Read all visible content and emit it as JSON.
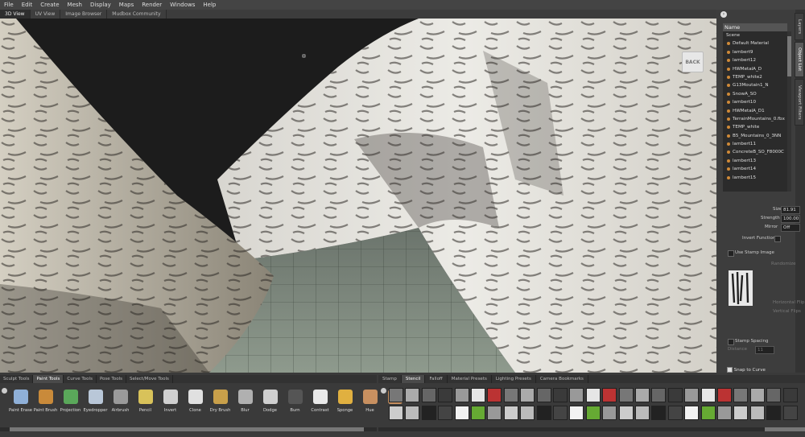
{
  "menu": [
    "File",
    "Edit",
    "Create",
    "Mesh",
    "Display",
    "Maps",
    "Render",
    "Windows",
    "Help"
  ],
  "view_tabs": [
    "3D View",
    "UV View",
    "Image Browser",
    "Mudbox Community"
  ],
  "back_label": "BACK",
  "side_tabs": [
    "Layers",
    "Object List",
    "Viewport Filters"
  ],
  "outliner": {
    "header": "Name",
    "scene": "Scene",
    "items": [
      "Default Material",
      "lambert9",
      "lambert12",
      "HWMetalA_D",
      "TEMP_white2",
      "G13Moutain1_N",
      "SnowA_SO",
      "lambert10",
      "HWMetalA_D1",
      "TerrainMountains_0.fbx",
      "TEMP_white",
      "B5_Mountains_0_3NN",
      "lambert11",
      "ConcreteB_SO_F8000C",
      "lambert13",
      "lambert14",
      "lambert15"
    ]
  },
  "props": {
    "size_label": "Size",
    "size_value": "81.91",
    "strength_label": "Strength",
    "strength_value": "100.00",
    "mirror_label": "Mirror",
    "mirror_value": "Off",
    "invert_label": "Invert Function",
    "use_stamp_label": "Use Stamp Image",
    "randomize_label": "Randomize",
    "horizontal_flip_label": "Horizontal Flip",
    "vertical_flip_label": "Vertical Flips",
    "stamp_spacing_label": "Stamp Spacing",
    "distance_label": "Distance",
    "distance_value": "11",
    "snap_label": "Snap to Curve"
  },
  "shelf_tabs": [
    "Sculpt Tools",
    "Paint Tools",
    "Curve Tools",
    "Pose Tools",
    "Select/Move Tools"
  ],
  "shelf_active": "Paint Tools",
  "tools": [
    {
      "label": "Paint Erase",
      "icon": "paint-erase-icon",
      "color": "#8fb0d8"
    },
    {
      "label": "Paint Brush",
      "icon": "paint-brush-icon",
      "color": "#c98a3a"
    },
    {
      "label": "Projection",
      "icon": "projection-icon",
      "color": "#5aa85a"
    },
    {
      "label": "Eyedropper",
      "icon": "eyedropper-icon",
      "color": "#b9c7d8"
    },
    {
      "label": "Airbrush",
      "icon": "airbrush-icon",
      "color": "#9a9a9a"
    },
    {
      "label": "Pencil",
      "icon": "pencil-icon",
      "color": "#d8c25a"
    },
    {
      "label": "Invert",
      "icon": "invert-icon",
      "color": "#d0d0d0"
    },
    {
      "label": "Clone",
      "icon": "clone-icon",
      "color": "#e0e0e0"
    },
    {
      "label": "Dry Brush",
      "icon": "dry-brush-icon",
      "color": "#c9a04a"
    },
    {
      "label": "Blur",
      "icon": "blur-icon",
      "color": "#b0b0b0"
    },
    {
      "label": "Dodge",
      "icon": "dodge-icon",
      "color": "#cfcfcf"
    },
    {
      "label": "Burn",
      "icon": "burn-icon",
      "color": "#555555"
    },
    {
      "label": "Contrast",
      "icon": "contrast-icon",
      "color": "#e8e8e8"
    },
    {
      "label": "Sponge",
      "icon": "sponge-icon",
      "color": "#e0b040"
    },
    {
      "label": "Hue",
      "icon": "hue-icon",
      "color": "#c89060"
    },
    {
      "label": "Hu",
      "icon": "hue-shift-icon",
      "color": "#c89060"
    }
  ],
  "lib_tabs": [
    "Stamp",
    "Stencil",
    "Falloff",
    "Material Presets",
    "Lighting Presets",
    "Camera Bookmarks"
  ],
  "lib_active": "Stencil"
}
